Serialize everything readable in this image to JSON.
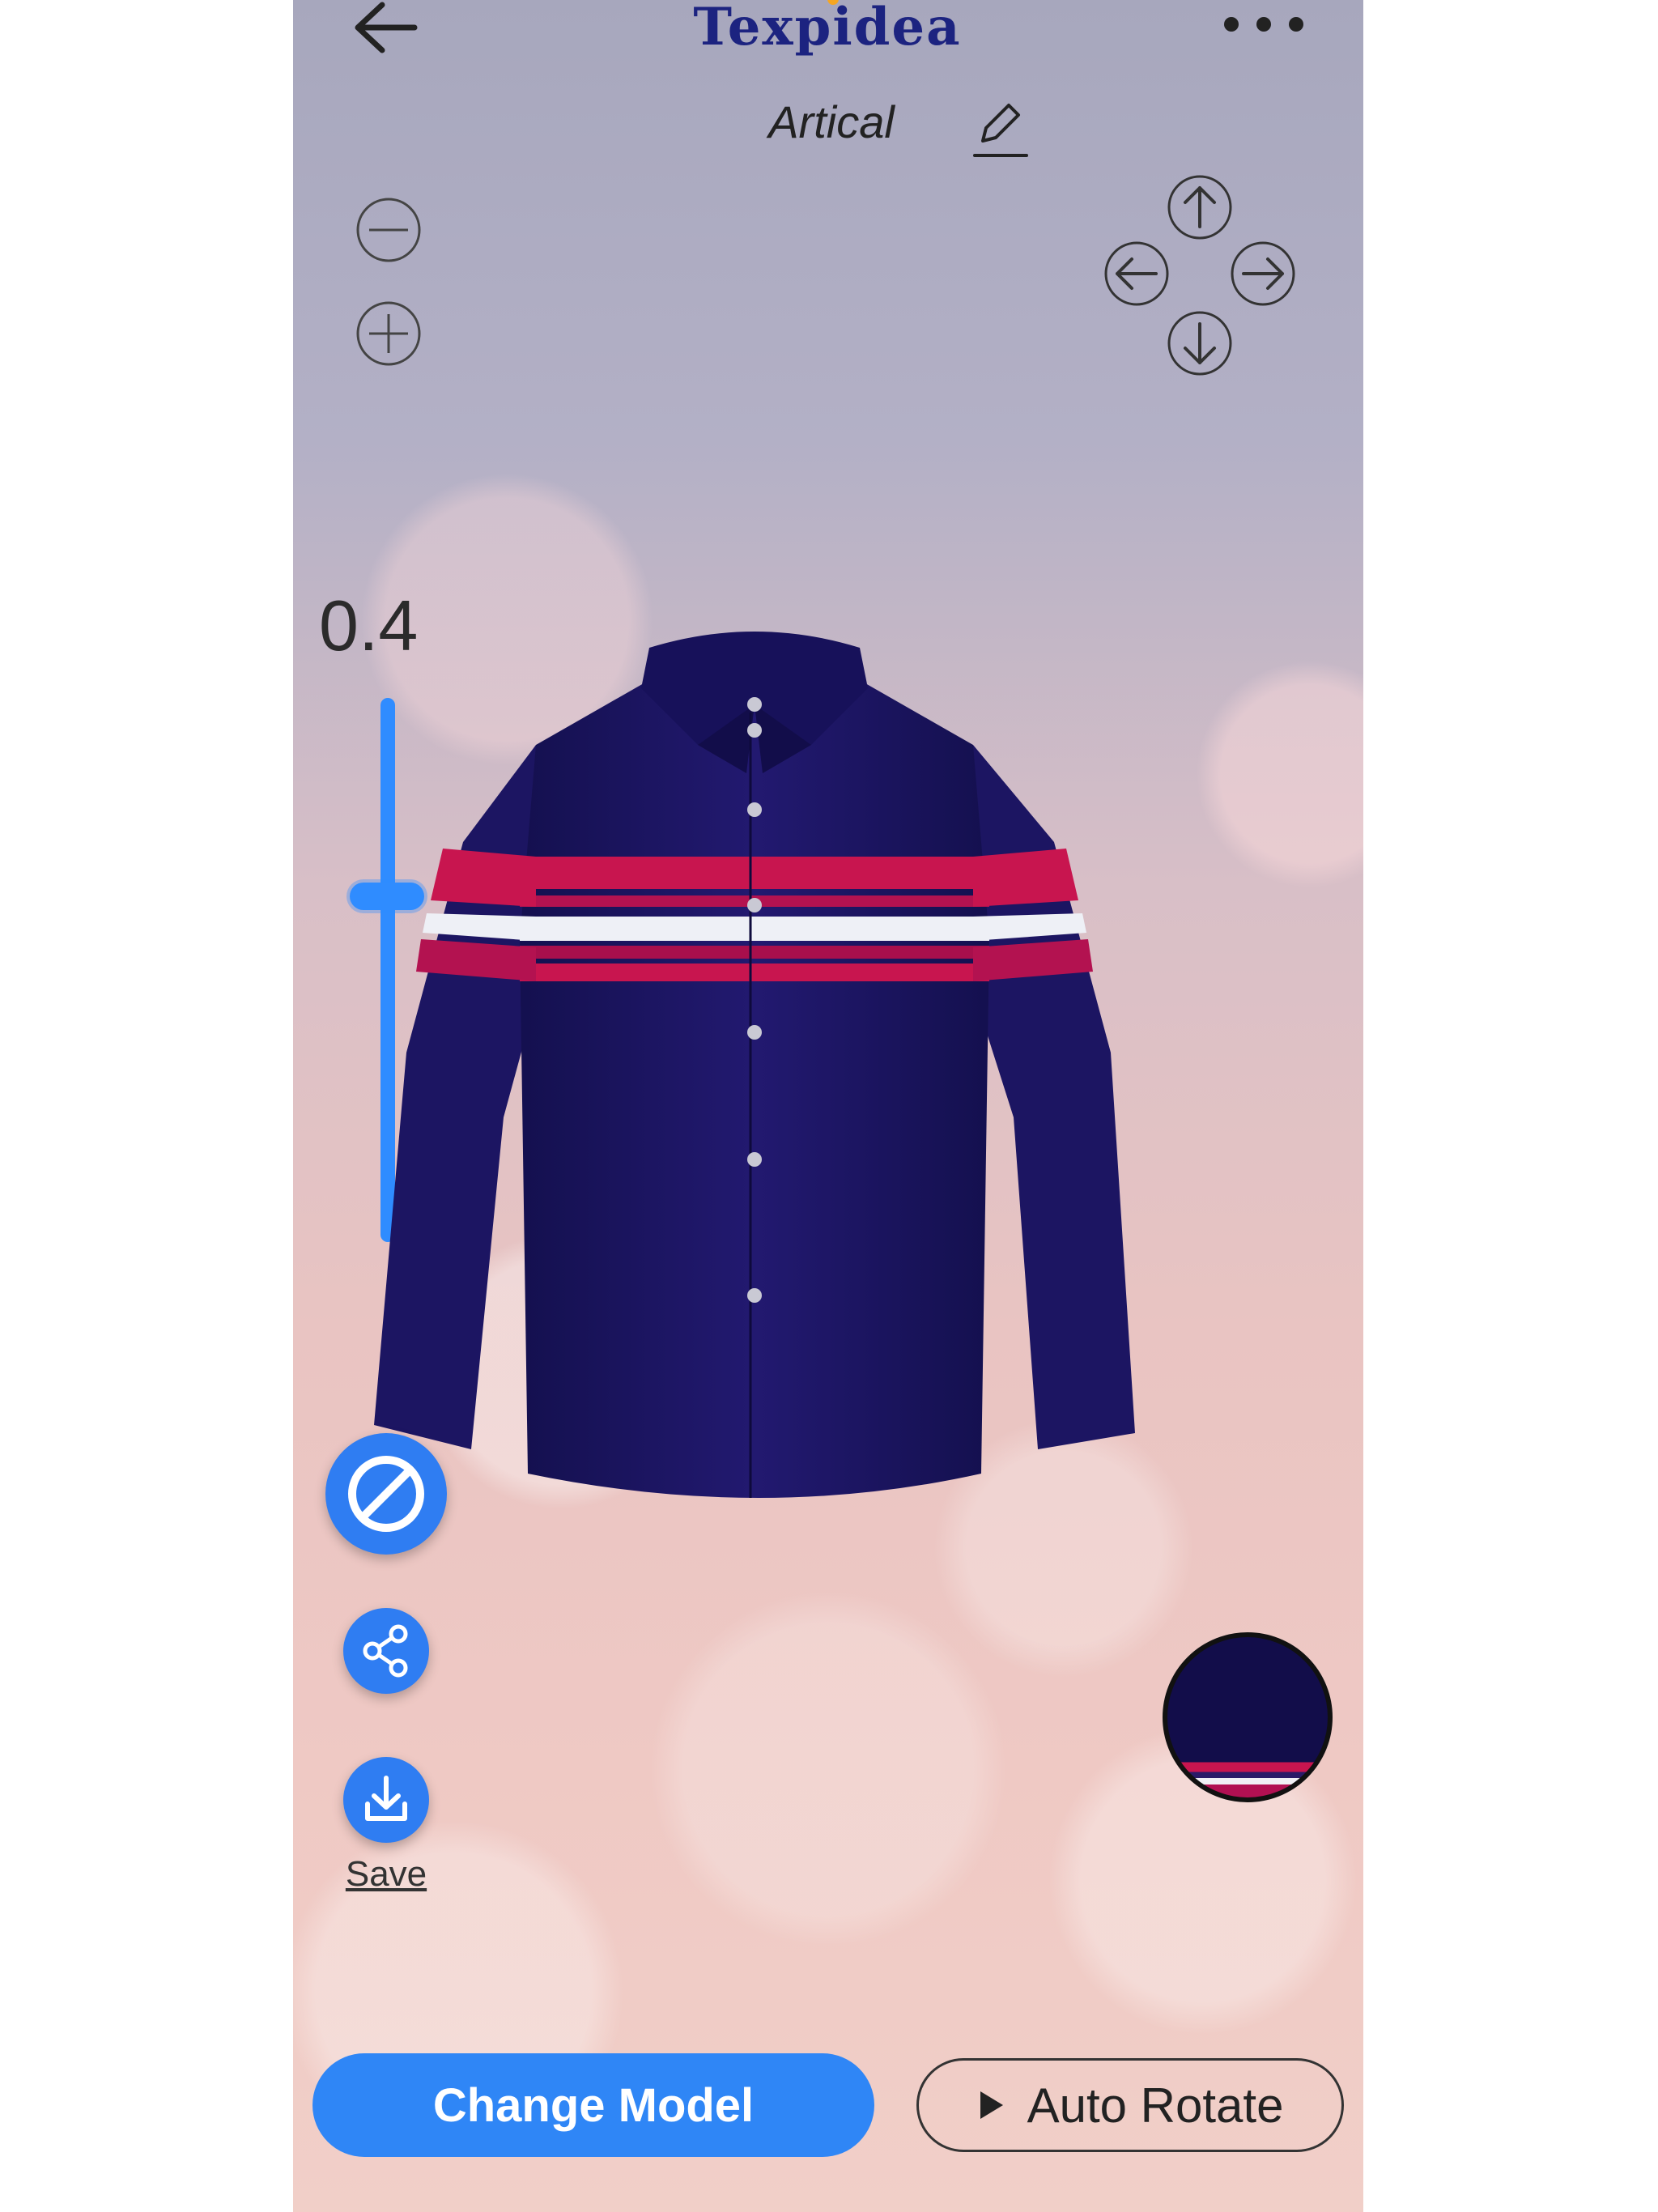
{
  "header": {
    "logo_text": "Texpidea",
    "title": "Artical",
    "back_icon": "arrow-left-icon",
    "menu_icon": "more-horizontal-icon",
    "edit_icon": "pencil-icon"
  },
  "controls": {
    "zoom_value": "0.4",
    "zoom_level": 0.4,
    "zoom_out_icon": "minus-circle-icon",
    "zoom_in_icon": "plus-circle-icon",
    "pan_icons": [
      "arrow-up-icon",
      "arrow-left-icon",
      "arrow-right-icon",
      "arrow-down-icon"
    ]
  },
  "side_actions": {
    "reset_icon": "block-icon",
    "share_icon": "share-icon",
    "save_icon": "download-icon",
    "save_label": "Save"
  },
  "buttons": {
    "change_model": "Change Model",
    "auto_rotate": "Auto Rotate",
    "play_icon": "play-icon"
  },
  "colors": {
    "accent": "#2f86f6",
    "shirt": "#1b1464",
    "stripe_red": "#c8154f",
    "stripe_white": "#f0f0f5",
    "logo": "#1c2380"
  }
}
